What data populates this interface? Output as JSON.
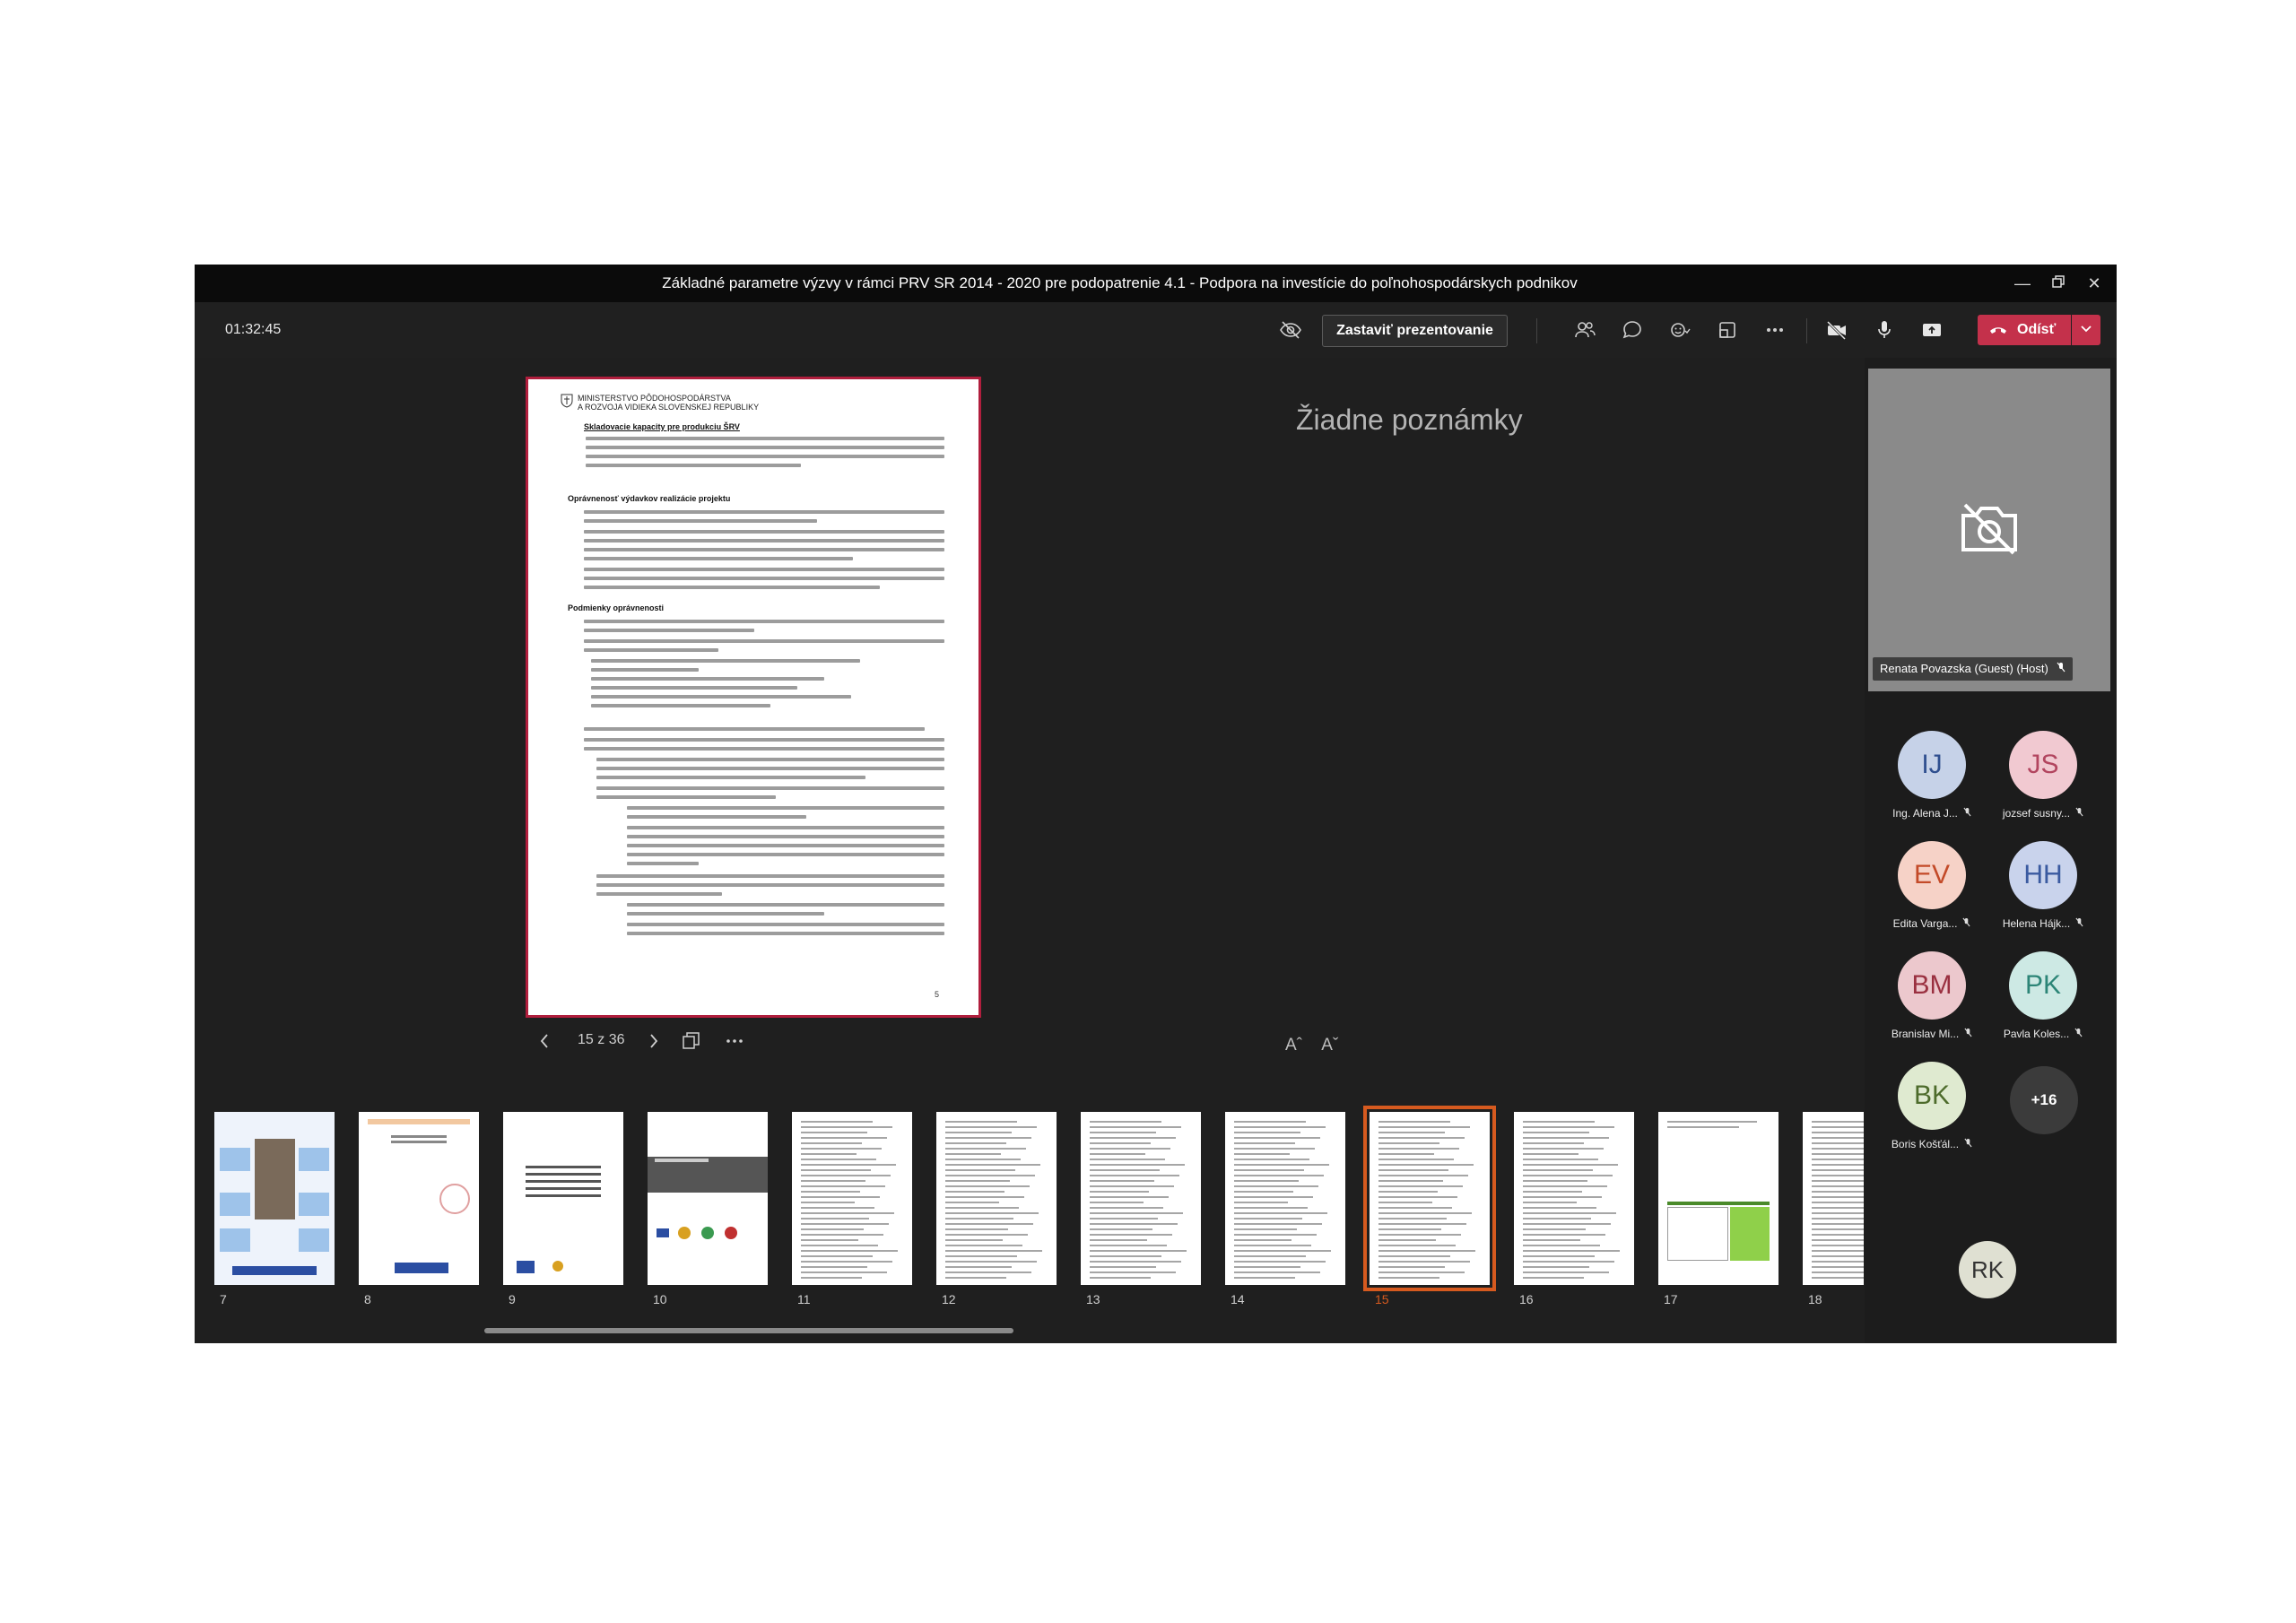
{
  "window": {
    "title": "Základné parametre výzvy v rámci PRV SR 2014 - 2020 pre podopatrenie 4.1 - Podpora na investície do poľnohospodárskych podnikov"
  },
  "toolbar": {
    "timer": "01:32:45",
    "stop_presenting": "Zastaviť prezentovanie",
    "leave": "Odísť",
    "icons": [
      "eye-off-icon",
      "people-icon",
      "chat-icon",
      "reactions-icon",
      "rooms-icon",
      "more-icon",
      "camera-off-icon",
      "mic-icon",
      "share-icon",
      "phone-icon",
      "chevron-down-icon"
    ],
    "leave_color": "#c4314b"
  },
  "slide": {
    "header_line1": "MINISTERSTVO PÔDOHOSPODÁRSTVA",
    "header_line2": "A ROZVOJA VIDIEKA SLOVENSKEJ REPUBLIKY",
    "section": "Skladovacie kapacity pre produkciu ŠRV",
    "heading1": "Oprávnenosť výdavkov realizácie projektu",
    "heading2": "Podmienky oprávnenosti",
    "page_number": "5",
    "border_color": "#b01e3d"
  },
  "slide_nav": {
    "position": "15 z 36"
  },
  "notes": {
    "text": "Žiadne poznámky"
  },
  "font_controls": {
    "decrease": "Aˆ",
    "increase": "Aˇ"
  },
  "host": {
    "name": "Renata Povazska (Guest) (Host)"
  },
  "participants": [
    {
      "initials": "IJ",
      "name": "Ing. Alena J...",
      "bg": "#c6d2e8",
      "fg": "#2f4f8f"
    },
    {
      "initials": "JS",
      "name": "jozsef susny...",
      "bg": "#f1c9d1",
      "fg": "#b2455f"
    },
    {
      "initials": "EV",
      "name": "Edita Varga...",
      "bg": "#f6d2c7",
      "fg": "#c34a28"
    },
    {
      "initials": "HH",
      "name": "Helena Hájk...",
      "bg": "#c9d3ec",
      "fg": "#3a5aa0"
    },
    {
      "initials": "BM",
      "name": "Branislav Mi...",
      "bg": "#ecc8cd",
      "fg": "#9a3040"
    },
    {
      "initials": "PK",
      "name": "Pavla Koles...",
      "bg": "#cde9e4",
      "fg": "#2c8577"
    },
    {
      "initials": "BK",
      "name": "Boris Košťál...",
      "bg": "#dfead0",
      "fg": "#4d6b2b"
    }
  ],
  "more_participants": "+16",
  "self": {
    "initials": "RK"
  },
  "thumbnails": [
    {
      "label": "7"
    },
    {
      "label": "8"
    },
    {
      "label": "9"
    },
    {
      "label": "10"
    },
    {
      "label": "11"
    },
    {
      "label": "12"
    },
    {
      "label": "13"
    },
    {
      "label": "14"
    },
    {
      "label": "15",
      "selected": true
    },
    {
      "label": "16"
    },
    {
      "label": "17"
    },
    {
      "label": "18"
    }
  ],
  "selected_color": "#d65a1f"
}
